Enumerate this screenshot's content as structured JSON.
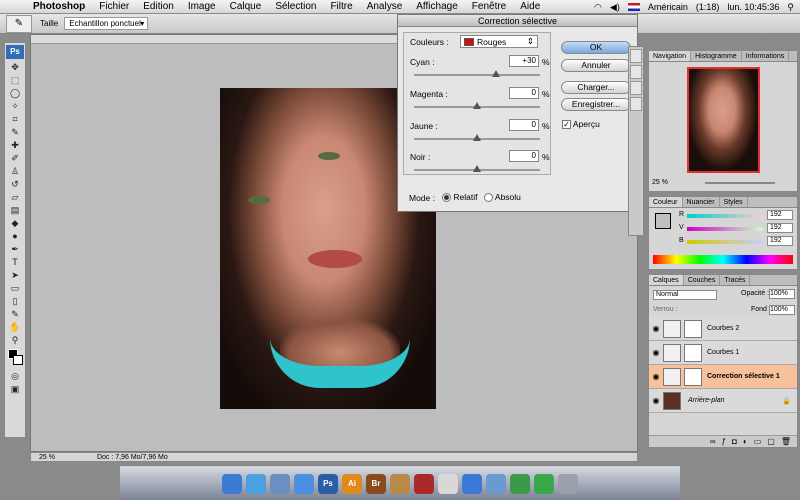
{
  "menubar": {
    "app": "Photoshop",
    "items": [
      "Fichier",
      "Edition",
      "Image",
      "Calque",
      "Sélection",
      "Filtre",
      "Analyse",
      "Affichage",
      "Fenêtre",
      "Aide"
    ],
    "keyboard": "Américain",
    "battery": "(1:18)",
    "clock": "lun. 10:45:36"
  },
  "options": {
    "size_label": "Taille",
    "sample": "Echantillon ponctuel"
  },
  "toolbox": {
    "logo": "Ps"
  },
  "document": {
    "zoom": "25 %",
    "doc_info": "Doc : 7,96 Mo/7,96 Mo"
  },
  "dialog": {
    "title": "Correction sélective",
    "colors_label": "Couleurs :",
    "colors_value": "Rouges",
    "colors_swatch": "#d01010",
    "sliders": [
      {
        "label": "Cyan :",
        "value": "+30",
        "pct": "%",
        "level": 65
      },
      {
        "label": "Magenta :",
        "value": "0",
        "pct": "%",
        "level": 50
      },
      {
        "label": "Jaune :",
        "value": "0",
        "pct": "%",
        "level": 50
      },
      {
        "label": "Noir :",
        "value": "0",
        "pct": "%",
        "level": 50
      }
    ],
    "mode_label": "Mode :",
    "mode_relative": "Relatif",
    "mode_absolute": "Absolu",
    "ok": "OK",
    "cancel": "Annuler",
    "load": "Charger...",
    "save": "Enregistrer...",
    "preview": "Aperçu"
  },
  "navigator": {
    "tabs": [
      "Navigation",
      "Histogramme",
      "Informations"
    ],
    "zoom": "25 %"
  },
  "color_panel": {
    "tabs": [
      "Couleur",
      "Nuancier",
      "Styles"
    ],
    "channels": [
      {
        "label": "R",
        "value": "192"
      },
      {
        "label": "V",
        "value": "192"
      },
      {
        "label": "B",
        "value": "192"
      }
    ]
  },
  "layers_panel": {
    "tabs": [
      "Calques",
      "Couches",
      "Tracés"
    ],
    "blend": "Normal",
    "opacity_label": "Opacité :",
    "opacity": "100%",
    "lock_label": "Verrou :",
    "fill_label": "Fond :",
    "fill": "100%",
    "layers": [
      {
        "name": "Courbes 2",
        "selected": false
      },
      {
        "name": "Courbes 1",
        "selected": false
      },
      {
        "name": "Correction sélective 1",
        "selected": true
      },
      {
        "name": "Arrière-plan",
        "selected": false
      }
    ]
  },
  "dock": {
    "icons": [
      {
        "name": "finder-icon",
        "color": "#3b7bd6",
        "text": ""
      },
      {
        "name": "safari-icon",
        "color": "#4aa0e0",
        "text": ""
      },
      {
        "name": "mail-icon",
        "color": "#6a8fc0",
        "text": ""
      },
      {
        "name": "itunes-icon",
        "color": "#4c8ee0",
        "text": ""
      },
      {
        "name": "photoshop-icon",
        "color": "#2a5fa6",
        "text": "Ps"
      },
      {
        "name": "illustrator-icon",
        "color": "#e08a1c",
        "text": "Ai"
      },
      {
        "name": "bridge-icon",
        "color": "#8a4a1c",
        "text": "Br"
      },
      {
        "name": "address-book-icon",
        "color": "#b88a4a",
        "text": ""
      },
      {
        "name": "photo-booth-icon",
        "color": "#aa2a2a",
        "text": ""
      },
      {
        "name": "ical-icon",
        "color": "#d8d8d8",
        "text": ""
      },
      {
        "name": "quicktime-icon",
        "color": "#3a7ad6",
        "text": ""
      },
      {
        "name": "preview-icon",
        "color": "#6a9ad0",
        "text": ""
      },
      {
        "name": "chrome-icon",
        "color": "#3a9a4a",
        "text": ""
      },
      {
        "name": "app-store-icon",
        "color": "#3aa84a",
        "text": ""
      },
      {
        "name": "trash-icon",
        "color": "#9aa0aa",
        "text": ""
      }
    ]
  }
}
